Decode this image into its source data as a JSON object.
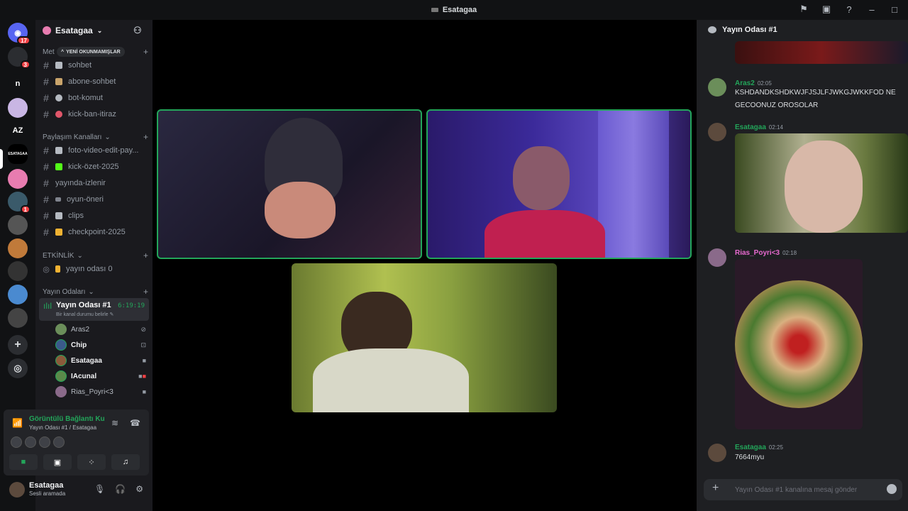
{
  "window": {
    "title": "Esatagaa"
  },
  "servers": {
    "badges": [
      "17",
      "3",
      "1"
    ],
    "items": [
      {
        "label": "n"
      },
      {
        "label": "AZ"
      },
      {
        "label": "ESATAGAA"
      }
    ]
  },
  "guild": {
    "name": "Esatagaa"
  },
  "categories": {
    "text": "Met",
    "unread_pill": "YENİ OKUNMAMIŞLAR",
    "share": "Paylaşım Kanalları",
    "event": "ETKİNLİK",
    "broadcast": "Yayın Odaları"
  },
  "channels": [
    {
      "name": "sohbet",
      "color": "#b5bac1"
    },
    {
      "name": "abone-sohbet",
      "color": "#c9a46b"
    },
    {
      "name": "bot-komut",
      "color": "#b5bac1"
    },
    {
      "name": "kick-ban-itiraz",
      "color": "#e0566a"
    }
  ],
  "share_channels": [
    {
      "name": "foto-video-edit-pay...",
      "color": "#b5bac1"
    },
    {
      "name": "kick-özet-2025",
      "color": "#53fc18"
    },
    {
      "name": "yayında-izlenir",
      "color": "#b5bac1"
    },
    {
      "name": "oyun-öneri",
      "color": "#80848e"
    },
    {
      "name": "clips",
      "color": "#b5bac1"
    },
    {
      "name": "checkpoint-2025",
      "color": "#f0b232"
    }
  ],
  "event_channels": [
    {
      "name": "yayın odası 0"
    }
  ],
  "voice": {
    "channel": "Yayın Odası #1",
    "timer": "6:19:19",
    "status": "Bir kanal durumu belirle",
    "users": [
      {
        "name": "Aras2",
        "color": "#6b8e5a"
      },
      {
        "name": "Chip",
        "color": "#3a5a8a"
      },
      {
        "name": "Esatagaa",
        "color": "#8a5a3a"
      },
      {
        "name": "IAcunal",
        "color": "#5a8a4a"
      },
      {
        "name": "Rias_Poyri<3",
        "color": "#8a6a8a"
      }
    ]
  },
  "rtc": {
    "title": "Görüntülü Bağlantı Ku",
    "sub": "Yayın Odası #1 / Esatagaa"
  },
  "user": {
    "name": "Esatagaa",
    "status": "Sesli aramada"
  },
  "chat": {
    "header": "Yayın Odası #1",
    "messages": [
      {
        "author": "Aras2",
        "time": "02:05",
        "text": "KSHDANDKSHDKWJFJSJLFJWKGJWKKFOD NE GECOONUZ OROSOLAR",
        "color": "#23a55a"
      },
      {
        "author": "Esatagaa",
        "time": "02:14",
        "text": "",
        "color": "#23a55a"
      },
      {
        "author": "Rias_Poyri<3",
        "time": "02:18",
        "text": "",
        "color": "#e86ad0"
      },
      {
        "author": "Esatagaa",
        "time": "02:25",
        "text": "7664myu",
        "color": "#23a55a"
      }
    ],
    "placeholder": "Yayın Odası #1 kanalına mesaj gönder"
  }
}
